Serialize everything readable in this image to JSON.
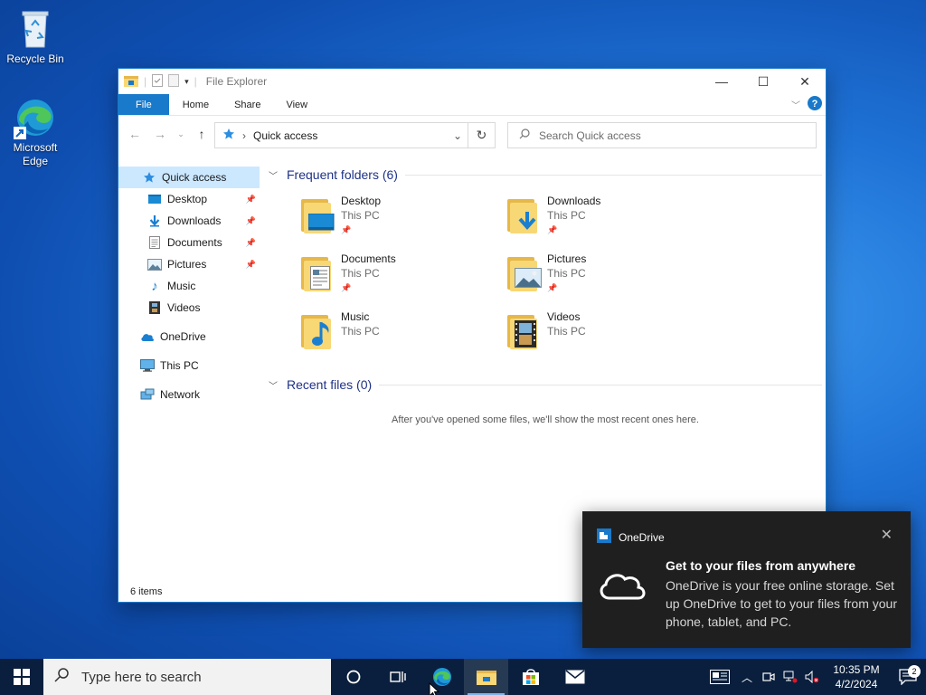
{
  "desktop": {
    "icons": [
      {
        "label": "Recycle Bin"
      },
      {
        "label": "Microsoft Edge"
      }
    ]
  },
  "explorer": {
    "title": "File Explorer",
    "ribbon_tabs": [
      "File",
      "Home",
      "Share",
      "View"
    ],
    "address": "Quick access",
    "search_placeholder": "Search Quick access",
    "nav": [
      {
        "label": "Quick access"
      },
      {
        "label": "Desktop"
      },
      {
        "label": "Downloads"
      },
      {
        "label": "Documents"
      },
      {
        "label": "Pictures"
      },
      {
        "label": "Music"
      },
      {
        "label": "Videos"
      },
      {
        "label": "OneDrive"
      },
      {
        "label": "This PC"
      },
      {
        "label": "Network"
      }
    ],
    "frequent_header": "Frequent folders (6)",
    "folders": [
      {
        "name": "Desktop",
        "location": "This PC"
      },
      {
        "name": "Downloads",
        "location": "This PC"
      },
      {
        "name": "Documents",
        "location": "This PC"
      },
      {
        "name": "Pictures",
        "location": "This PC"
      },
      {
        "name": "Music",
        "location": "This PC"
      },
      {
        "name": "Videos",
        "location": "This PC"
      }
    ],
    "recent_header": "Recent files (0)",
    "recent_empty": "After you've opened some files, we'll show the most recent ones here.",
    "status": "6 items"
  },
  "toast": {
    "app": "OneDrive",
    "heading": "Get to your files from anywhere",
    "body": "OneDrive is your free online storage. Set up OneDrive to get to your files from your phone, tablet, and PC."
  },
  "taskbar": {
    "search_placeholder": "Type here to search",
    "time": "10:35 PM",
    "date": "4/2/2024",
    "notification_count": "2"
  },
  "colors": {
    "accent": "#1979ca",
    "selection": "#cce8ff",
    "section_header": "#1e3287",
    "taskbar": "#0a1f3d"
  }
}
